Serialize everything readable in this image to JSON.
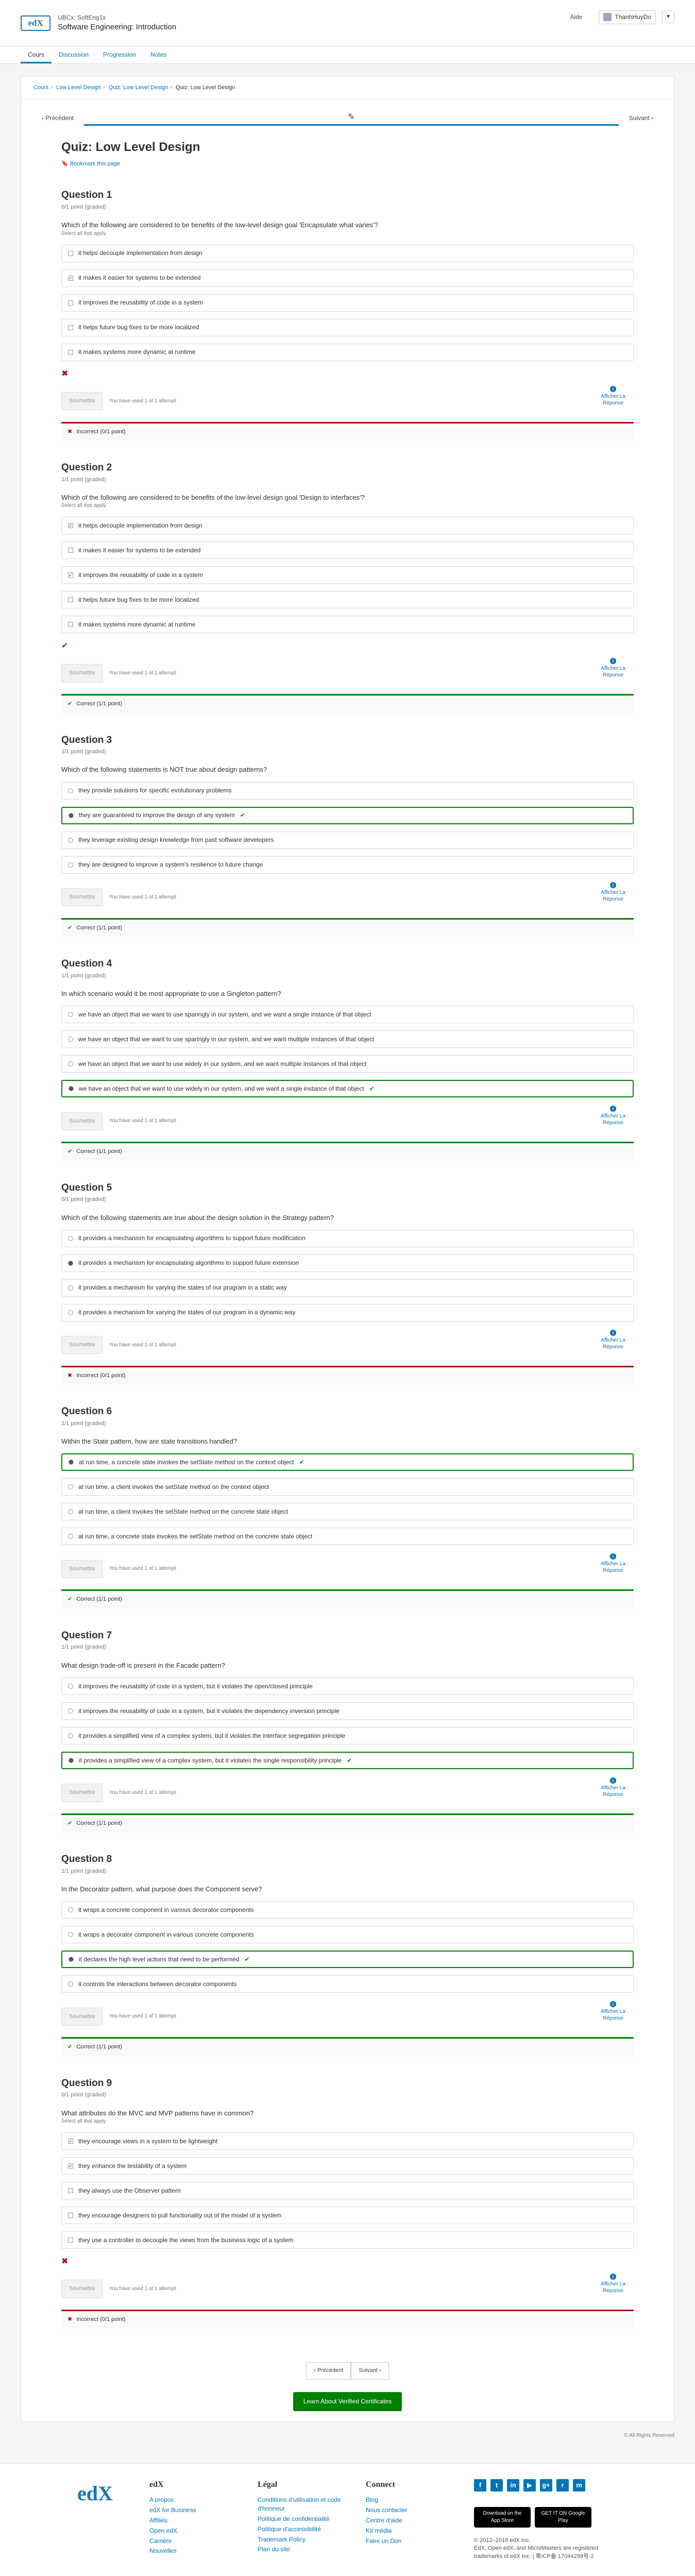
{
  "header": {
    "logo": "edX",
    "course_org": "UBCx: SoftEng1x",
    "course_title": "Software Engineering: Introduction",
    "help": "Aide",
    "username": "ThanhHuyDo"
  },
  "tabs": [
    "Cours",
    "Discussion",
    "Progression",
    "Notes"
  ],
  "breadcrumbs": [
    "Cours",
    "Low Level Design",
    "Quiz: Low Level Design",
    "Quiz: Low Level Design"
  ],
  "seq": {
    "prev": "Précédent",
    "next": "Suivant"
  },
  "unit": {
    "title": "Quiz: Low Level Design",
    "bookmark": "Bookmark this page"
  },
  "ui": {
    "submit": "Soumettre",
    "show_answer": "Afficher La Réponse",
    "correct1": "Correct (1/1 point)",
    "incorrect0": "Incorrect (0/1 point)"
  },
  "questions": [
    {
      "title": "Question 1",
      "score": "0/1 point (graded)",
      "text": "Which of the following are considered to be benefits of the low-level design goal 'Encapsulate what varies'?",
      "hint": "Select all that apply",
      "choices": [
        "it helps decouple implementation from design",
        "it makes it easier for systems to be extended",
        "it improves the reusability of code in a system",
        "it helps future bug fixes to be more localized",
        "it makes systems more dynamic at runtime"
      ],
      "attempts": "You have used 1 of 1 attempt",
      "status": "Incorrect (0/1 point)"
    },
    {
      "title": "Question 2",
      "score": "1/1 point (graded)",
      "text": "Which of the following are considered to be benefits of the low-level design goal 'Design to interfaces'?",
      "hint": "Select all that apply",
      "choices": [
        "it helps decouple implementation from design",
        "it makes it easier for systems to be extended",
        "it improves the reusability of code in a system",
        "it helps future bug fixes to be more localized",
        "it makes systems more dynamic at runtime"
      ],
      "attempts": "You have used 1 of 1 attempt",
      "status": "Correct (1/1 point)"
    },
    {
      "title": "Question 3",
      "score": "1/1 point (graded)",
      "text": "Which of the following statements is NOT true about design patterns?",
      "hint": "",
      "choices": [
        "they provide solutions for specific evolutionary problems",
        "they are guaranteed to improve the design of any system",
        "they leverage existing design knowledge from past software developers",
        "they are designed to improve a system's resilience to future change"
      ],
      "attempts": "You have used 1 of 1 attempt",
      "status": "Correct (1/1 point)"
    },
    {
      "title": "Question 4",
      "score": "1/1 point (graded)",
      "text": "In which scenario would it be most appropriate to use a Singleton pattern?",
      "hint": "",
      "choices": [
        "we have an object that we want to use sparingly in our system, and we want a single instance of that object",
        "we have an object that we want to use sparingly in our system, and we want multiple instances of that object",
        "we have an object that we want to use widely in our system, and we want multiple instances of that object",
        "we have an object that we want to use widely in our system, and we want a single instance of that object"
      ],
      "attempts": "You have used 1 of 1 attempt",
      "status": "Correct (1/1 point)"
    },
    {
      "title": "Question 5",
      "score": "0/1 point (graded)",
      "text": "Which of the following statements are true about the design solution in the Strategy pattern?",
      "hint": "",
      "choices": [
        "it provides a mechanism for encapsulating algorithms to support future modification",
        "it provides a mechanism for encapsulating algorithms to support future extension",
        "it provides a mechanism for varying the states of our program in a static way",
        "it provides a mechanism for varying the states of our program in a dynamic way"
      ],
      "attempts": "You have used 1 of 1 attempt",
      "status": "Incorrect (0/1 point)"
    },
    {
      "title": "Question 6",
      "score": "1/1 point (graded)",
      "text": "Within the State pattern, how are state transitions handled?",
      "hint": "",
      "choices": [
        "at run time, a concrete state invokes the setState method on the context object",
        "at run time, a client invokes the setState method on the context object",
        "at run time, a client invokes the setState method on the concrete state object",
        "at run time, a concrete state invokes the setState method on the concrete state object"
      ],
      "attempts": "You have used 1 of 1 attempt",
      "status": "Correct (1/1 point)"
    },
    {
      "title": "Question 7",
      "score": "1/1 point (graded)",
      "text": "What design trade-off is present in the Facade pattern?",
      "hint": "",
      "choices": [
        "it improves the reusability of code in a system, but it violates the open/closed principle",
        "it improves the reusability of code in a system, but it violates the dependency inversion principle",
        "it provides a simplified view of a complex system, but it violates the interface segregation principle",
        "it provides a simplified view of a complex system, but it violates the single responsibility principle"
      ],
      "attempts": "You have used 1 of 1 attempt",
      "status": "Correct (1/1 point)"
    },
    {
      "title": "Question 8",
      "score": "1/1 point (graded)",
      "text": "In the Decorator pattern, what purpose does the Component serve?",
      "hint": "",
      "choices": [
        "it wraps a concrete component in various decorator components",
        "it wraps a decorator component in various concrete components",
        "it declares the high level actions that need to be performed",
        "it controls the interactions between decorator components"
      ],
      "attempts": "You have used 1 of 1 attempt",
      "status": "Correct (1/1 point)"
    },
    {
      "title": "Question 9",
      "score": "0/1 point (graded)",
      "text": "What attributes do the MVC and MVP patterns have in common?",
      "hint": "Select all that apply",
      "choices": [
        "they encourage views in a system to be lightweight",
        "they enhance the testability of a system",
        "they always use the Observer pattern",
        "they encourage designers to pull functionality out of the model of a system",
        "they use a controller to decouple the views from the business logic of a system"
      ],
      "attempts": "You have used 1 of 1 attempt",
      "status": "Incorrect (0/1 point)"
    }
  ],
  "bottom_nav": {
    "prev": "Précédent",
    "next": "Suivant"
  },
  "verify": "Learn About Verified Certificates",
  "rights": "© All Rights Reserved",
  "footer": {
    "logo": "edX",
    "col1_title": "edX",
    "col1": [
      "A propos",
      "edX for Business",
      "Affiliés",
      "Open edX",
      "Carrière",
      "Nouvelles"
    ],
    "col2_title": "Légal",
    "col2": [
      "Conditions d'utilisation et code d'honneur",
      "Politique de confidentialité",
      "Politique d'accessibilité",
      "Trademark Policy",
      "Plan du site"
    ],
    "col3_title": "Connect",
    "col3": [
      "Blog",
      "Nous contacter",
      "Centre d'aide",
      "Kit média",
      "Faire un Don"
    ],
    "appstore": "Download on the App Store",
    "googleplay": "GET IT ON Google Play",
    "copyright": "© 2012–2018 edX Inc.",
    "trademark": "EdX, Open edX, and MicroMasters are registered trademarks of edX Inc. | 粤ICP备 17044299号-2"
  }
}
